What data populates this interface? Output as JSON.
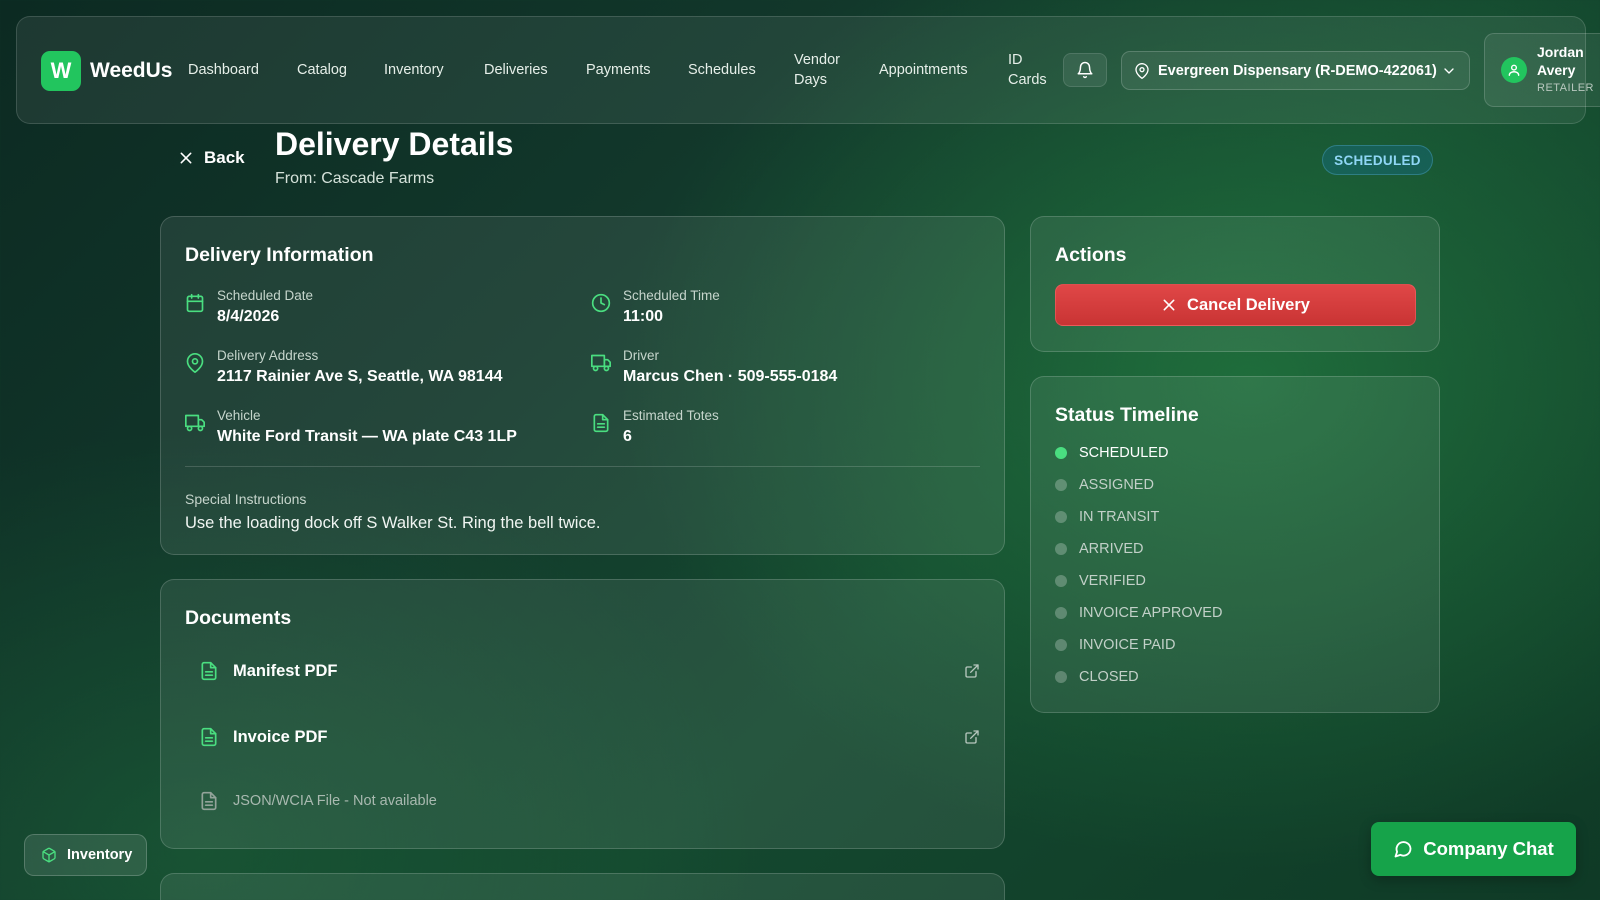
{
  "app": {
    "logo_letter": "W",
    "name": "WeedUs"
  },
  "nav": {
    "links": [
      "Dashboard",
      "Catalog",
      "Inventory",
      "Deliveries",
      "Payments",
      "Schedules",
      "Vendor\nDays",
      "Appointments",
      "ID\nCards"
    ],
    "location": "Evergreen Dispensary (R-DEMO-422061)",
    "user_name": "Jordan Avery",
    "user_role": "RETAILER"
  },
  "header": {
    "back_label": "Back",
    "title": "Delivery Details",
    "subtitle": "From: Cascade Farms",
    "status": "SCHEDULED"
  },
  "delivery_info": {
    "title": "Delivery Information",
    "items": [
      {
        "icon": "calendar-icon",
        "label": "Scheduled Date",
        "value": "8/4/2026"
      },
      {
        "icon": "clock-icon",
        "label": "Scheduled Time",
        "value": "11:00"
      },
      {
        "icon": "map-pin-icon",
        "label": "Delivery Address",
        "value": "2117 Rainier Ave S, Seattle, WA 98144"
      },
      {
        "icon": "truck-icon",
        "label": "Driver",
        "value": "Marcus Chen · 509-555-0184"
      },
      {
        "icon": "truck-icon",
        "label": "Vehicle",
        "value": "White Ford Transit — WA plate C43 1LP"
      },
      {
        "icon": "document-icon",
        "label": "Estimated Totes",
        "value": "6"
      }
    ],
    "special_label": "Special Instructions",
    "special_value": "Use the loading dock off S Walker St. Ring the bell twice."
  },
  "documents": {
    "title": "Documents",
    "items": [
      {
        "name": "Manifest PDF",
        "available": true
      },
      {
        "name": "Invoice PDF",
        "available": true
      },
      {
        "name": "JSON/WCIA File - Not available",
        "available": false
      }
    ]
  },
  "actions": {
    "title": "Actions",
    "cancel_label": "Cancel Delivery"
  },
  "timeline": {
    "title": "Status Timeline",
    "steps": [
      "SCHEDULED",
      "ASSIGNED",
      "IN TRANSIT",
      "ARRIVED",
      "VERIFIED",
      "INVOICE APPROVED",
      "INVOICE PAID",
      "CLOSED"
    ],
    "active_step": "SCHEDULED"
  },
  "floating": {
    "inventory_label": "Inventory",
    "chat_label": "Company Chat"
  },
  "colors": {
    "accent": "#22c55e",
    "danger": "#d63c3c",
    "status_badge": "#8fd6f5"
  }
}
